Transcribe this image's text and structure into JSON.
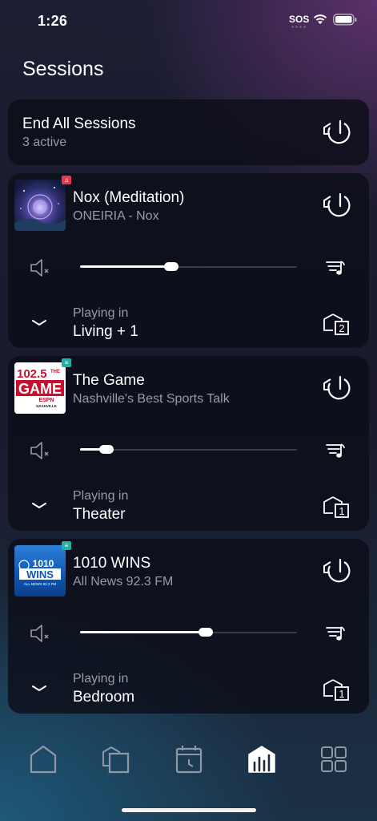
{
  "status": {
    "time": "1:26",
    "sos": "SOS"
  },
  "page": {
    "title": "Sessions"
  },
  "end_all": {
    "title": "End All Sessions",
    "subtitle": "3 active"
  },
  "sessions": [
    {
      "title": "Nox (Meditation)",
      "subtitle": "ONEIRIA - Nox",
      "volume": 0.42,
      "playing_in_label": "Playing in",
      "room": "Living + 1",
      "room_count": "2",
      "source_icon": "apple-music-icon",
      "source_color": "#e8384f"
    },
    {
      "title": "The Game",
      "subtitle": "Nashville's Best Sports Talk",
      "volume": 0.12,
      "playing_in_label": "Playing in",
      "room": "Theater",
      "room_count": "1",
      "source_icon": "radio-source-icon",
      "source_color": "#1fb3a6",
      "art": {
        "freq": "102.5",
        "the": "THE",
        "game": "GAME",
        "espn": "ESPN",
        "city": "NASHVILLE"
      }
    },
    {
      "title": "1010 WINS",
      "subtitle": "All News 92.3 FM",
      "volume": 0.58,
      "playing_in_label": "Playing in",
      "room": "Bedroom",
      "room_count": "1",
      "source_icon": "radio-source-icon",
      "source_color": "#1fb3a6",
      "art": {
        "freq": "1010",
        "name": "WINS",
        "tag": "ALL NEWS 92.3 FM"
      }
    }
  ],
  "tabs": [
    {
      "name": "home",
      "icon": "home-icon"
    },
    {
      "name": "rooms",
      "icon": "rooms-icon"
    },
    {
      "name": "schedule",
      "icon": "calendar-icon"
    },
    {
      "name": "sessions",
      "icon": "sessions-icon",
      "active": true
    },
    {
      "name": "more",
      "icon": "grid-icon"
    }
  ],
  "colors": {
    "accent": "#ffffff",
    "muted_text": "#9a9aa6",
    "card_bg": "#0c0d18"
  }
}
